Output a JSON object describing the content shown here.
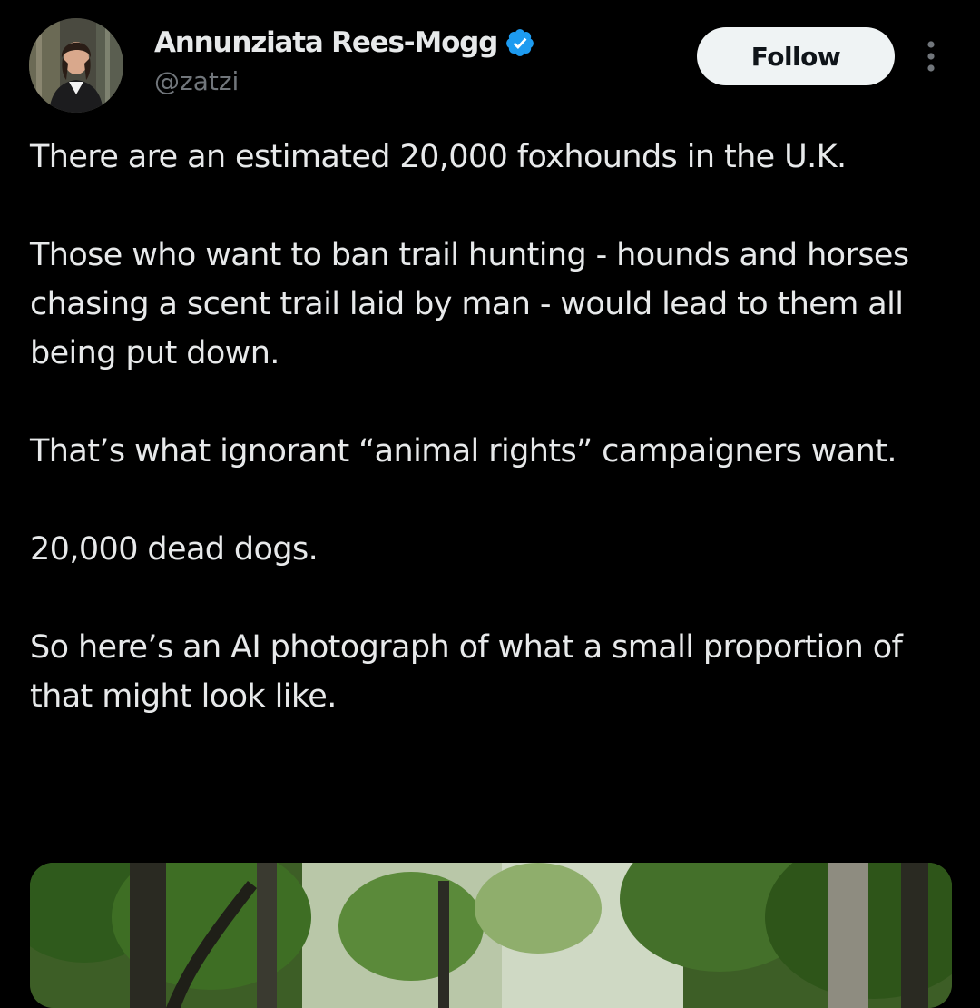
{
  "author": {
    "display_name": "Annunziata Rees-Mogg",
    "handle": "@zatzi",
    "verified": true
  },
  "actions": {
    "follow_label": "Follow",
    "more_icon": "more-vertical-icon"
  },
  "tweet": {
    "paragraphs": [
      "There are an estimated 20,000 foxhounds in the U.K.",
      "Those who want to ban trail hunting - hounds and horses chasing a scent trail laid by man - would lead to them all being put down.",
      "That’s what ignorant “animal rights” campaigners want.",
      "20,000 dead dogs.",
      "So here’s an AI photograph of what a small proportion of that might look like."
    ]
  },
  "colors": {
    "background": "#000000",
    "text_primary": "#e7e9ea",
    "text_secondary": "#71767b",
    "verified_badge": "#1d9bf0",
    "follow_button_bg": "#eff3f4"
  }
}
